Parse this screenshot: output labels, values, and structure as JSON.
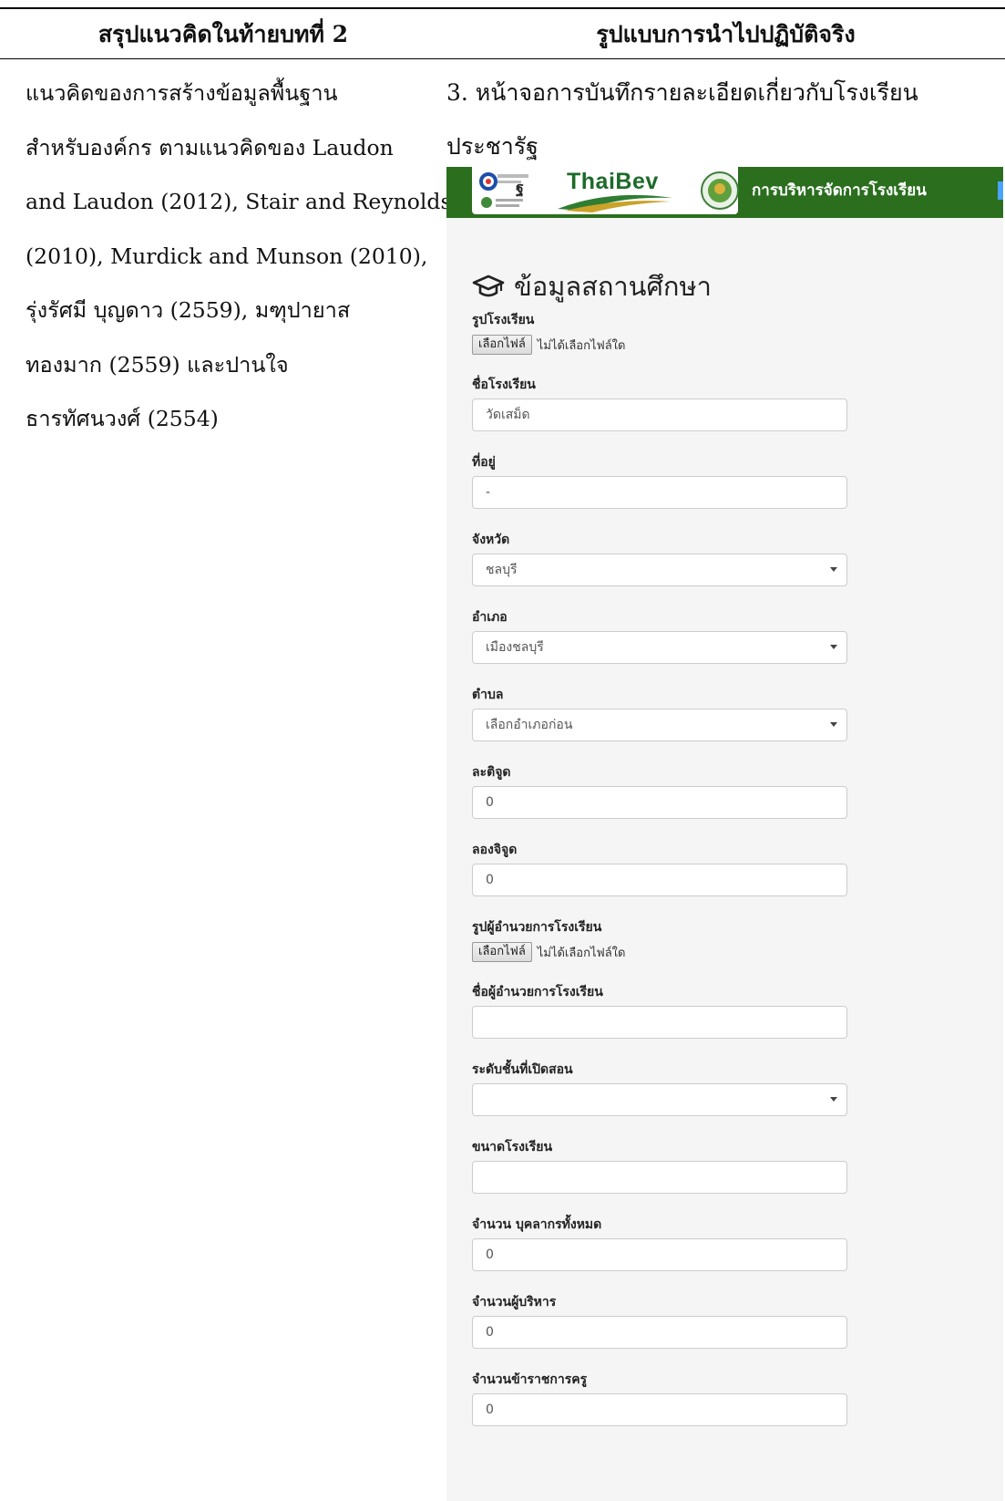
{
  "table_header": {
    "left": "สรุปแนวคิดในท้ายบทที่ 2",
    "right": "รูปแบบการนำไปปฏิบัติจริง"
  },
  "left_lines": [
    "แนวคิดของการสร้างข้อมูลพื้นฐาน",
    "สำหรับองค์กร ตามแนวคิดของ Laudon",
    "and Laudon (2012), Stair and Reynolds",
    "(2010), Murdick and Munson (2010),",
    "รุ่งรัศมี บุญดาว (2559), มฑุปายาส",
    "ทองมาก (2559) และปานใจ",
    "ธารทัศนวงศ์ (2554)"
  ],
  "right_lines": [
    "3. หน้าจอการบันทึกรายละเอียดเกี่ยวกับโรงเรียน",
    "ประชารัฐ"
  ],
  "screenshot": {
    "banner": {
      "brand": "ThaiBev",
      "title": "การบริหารจัดการโรงเรียน",
      "colors": {
        "banner": "#2a6e1e",
        "accent": "#4aa3ff"
      }
    },
    "page_title": "ข้อมูลสถานศึกษา",
    "page_icon": "graduation-cap-icon",
    "file_fields": [
      {
        "label": "รูปโรงเรียน",
        "button": "เลือกไฟล์",
        "status": "ไม่ได้เลือกไฟล์ใด"
      },
      {
        "label": "รูปผู้อำนวยการโรงเรียน",
        "button": "เลือกไฟล์",
        "status": "ไม่ได้เลือกไฟล์ใด"
      }
    ],
    "fields": {
      "school_name": {
        "label": "ชื่อโรงเรียน",
        "value": "วัดเสม็ด"
      },
      "address": {
        "label": "ที่อยู่",
        "value": "-"
      },
      "province": {
        "label": "จังหวัด",
        "value": "ชลบุรี"
      },
      "district": {
        "label": "อำเภอ",
        "value": "เมืองชลบุรี"
      },
      "subdistrict": {
        "label": "ตำบล",
        "value": "เลือกอำเภอก่อน"
      },
      "latitude": {
        "label": "ละติจูด",
        "value": "0"
      },
      "longitude": {
        "label": "ลองจิจูด",
        "value": "0"
      },
      "director_name": {
        "label": "ชื่อผู้อำนวยการโรงเรียน",
        "value": ""
      },
      "grade_levels": {
        "label": "ระดับชั้นที่เปิดสอน",
        "value": ""
      },
      "school_size": {
        "label": "ขนาดโรงเรียน",
        "value": ""
      },
      "total_staff": {
        "label": "จำนวน บุคลากรทั้งหมด",
        "value": "0"
      },
      "administrators": {
        "label": "จำนวนผู้บริหาร",
        "value": "0"
      },
      "teachers": {
        "label": "จำนวนข้าราชการครู",
        "value": "0"
      }
    }
  }
}
